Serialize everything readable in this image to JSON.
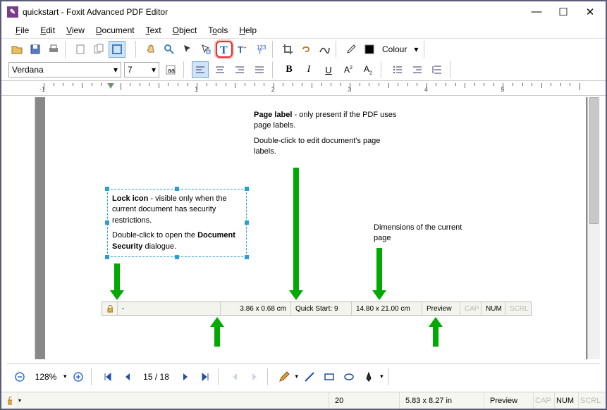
{
  "window": {
    "title": "quickstart - Foxit Advanced PDF Editor"
  },
  "menu": {
    "file": "File",
    "edit": "Edit",
    "view": "View",
    "document": "Document",
    "text": "Text",
    "object": "Object",
    "tools": "Tools",
    "help": "Help"
  },
  "toolbar": {
    "colour_label": "Colour"
  },
  "font": {
    "name": "Verdana",
    "size": "7"
  },
  "ruler": {
    "marks": [
      -1,
      1,
      2,
      3,
      4,
      5
    ]
  },
  "doc": {
    "callout1": {
      "bold1": "Page label",
      "rest1": " - only present if the PDF uses page labels.",
      "line2": "Double-click to edit document's page labels."
    },
    "callout2": {
      "bold1": "Lock icon",
      "rest1": " - visible only when the current document has security restrictions.",
      "line2a": "Double-click to open the ",
      "bold2": "Document Security",
      "line2b": " dialogue."
    },
    "callout3": {
      "text": "Dimensions of the current page"
    }
  },
  "inner_status": {
    "lock_dash": "-",
    "dims": "3.86 x 0.68 cm",
    "pagelabel": "Quick Start: 9",
    "pagedims": "14.80 x 21.00 cm",
    "preview": "Preview",
    "cap": "CAP",
    "num": "NUM",
    "scrl": "SCRL"
  },
  "nav": {
    "zoom": "128%",
    "page": "15 / 18"
  },
  "status": {
    "page_no": "20",
    "dims": "5.83 x 8.27 in",
    "preview": "Preview",
    "cap": "CAP",
    "num": "NUM",
    "scrl": "SCRL"
  }
}
